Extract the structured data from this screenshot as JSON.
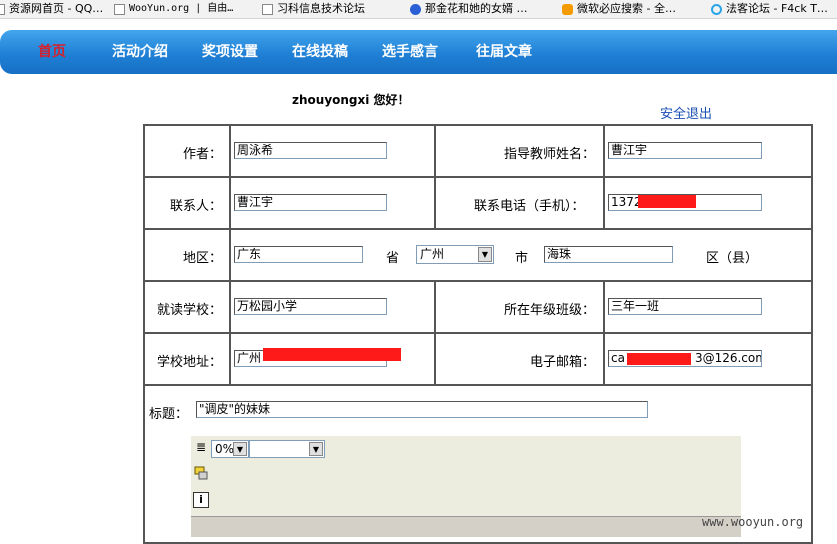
{
  "bookmarks": [
    {
      "label": "资源网首页 - QQ…",
      "icon": "page-icon"
    },
    {
      "label": "WooYun.org | 自由…",
      "icon": "page-icon"
    },
    {
      "label": "习科信息技术论坛",
      "icon": "page-icon"
    },
    {
      "label": "那金花和她的女婿 …",
      "icon": "baidu-paw-icon"
    },
    {
      "label": "微软必应搜索 - 全…",
      "icon": "bing-s-icon"
    },
    {
      "label": "法客论坛 - F4ck T…",
      "icon": "q-icon"
    }
  ],
  "nav": {
    "items": [
      "首页",
      "活动介绍",
      "奖项设置",
      "在线投稿",
      "选手感言",
      "往届文章"
    ],
    "active_index": 0,
    "active_color": "#d6202a"
  },
  "greeting": "zhouyongxi 您好！",
  "logout_label": "安全退出",
  "form": {
    "author_label": "作者：",
    "author_value": "周泳希",
    "teacher_label": "指导教师姓名：",
    "teacher_value": "曹江宇",
    "contact_label": "联系人：",
    "contact_value": "曹江宇",
    "phone_label": "联系电话（手机）：",
    "phone_value": "1372",
    "region_label": "地区：",
    "province_value": "广东",
    "province_unit": "省",
    "city_value": "广州",
    "city_unit": "市",
    "district_value": "海珠",
    "district_unit": "区（县）",
    "school_label": "就读学校：",
    "school_value": "万松园小学",
    "grade_label": "所在年级班级：",
    "grade_value": "三年一班",
    "address_label": "学校地址：",
    "address_value": "广州",
    "email_label": "电子邮箱：",
    "email_value_start": "ca",
    "email_value_end": "3@126.com",
    "title_label": "标题：",
    "title_value": "\"调皮\"的妹妹",
    "zoom_value": "0%",
    "redaction_color": "#ff1a1a"
  },
  "watermark": "www.wooyun.org"
}
